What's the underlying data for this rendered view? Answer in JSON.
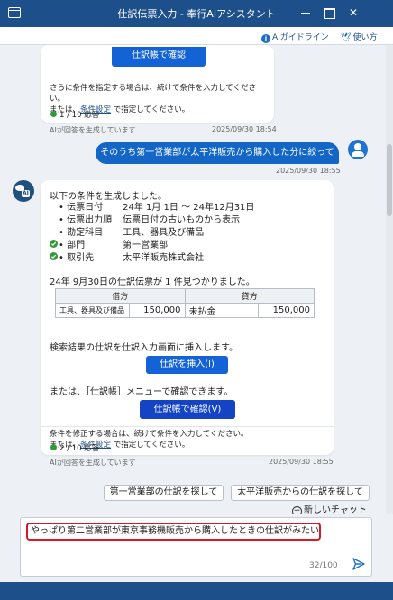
{
  "window": {
    "title": "仕訳伝票入力 - 奉行AIアシスタント"
  },
  "topbar": {
    "guide_label": "AIガイドライン",
    "usage_label": "使い方"
  },
  "msg1": {
    "button_label": "仕訳帳で確認",
    "line1": "さらに条件を指定する場合は、続けて条件を入力してください。",
    "line2_prefix": "または、",
    "link": "条件設定",
    "line2_suffix": " で指定してください。",
    "count": "1 / 10 応答",
    "note": "AIが回答を生成しています",
    "time": "2025/09/30 18:54"
  },
  "user_msg": {
    "text": "そのうち第一営業部が太平洋販売から購入した分に絞って",
    "time": "2025/09/30 18:55"
  },
  "msg2": {
    "intro": "以下の条件を生成しました。",
    "conditions": [
      {
        "label": "伝票日付",
        "value": "24年 1月 1日 ～ 24年12月31日"
      },
      {
        "label": "伝票出力順",
        "value": "伝票日付の古いものから表示"
      },
      {
        "label": "勘定科目",
        "value": "工具、器具及び備品"
      },
      {
        "label": "部門",
        "value": "第一営業部"
      },
      {
        "label": "取引先",
        "value": "太平洋販売株式会社"
      }
    ],
    "result": "24年 9月30日の仕訳伝票が 1 件見つかりました。",
    "table": {
      "debit_header": "借方",
      "credit_header": "貸方",
      "debit_account": "工具、器具及び備品",
      "debit_amount": "150,000",
      "credit_account": "未払金",
      "credit_amount": "150,000"
    },
    "insert_text": "検索結果の仕訳を仕訳入力画面に挿入します。",
    "insert_button": "仕訳を挿入(I)",
    "menu_text": "または、［仕訳帳］メニューで確認できます。",
    "confirm_button": "仕訳帳で確認(V)",
    "line1": "条件を修正する場合は、続けて条件を入力してください。",
    "line2_prefix": "または、",
    "link": "条件設定",
    "line2_suffix": " で指定してください。",
    "count": "2 / 10 応答",
    "note": "AIが回答を生成しています",
    "time": "2025/09/30 18:55"
  },
  "suggestions": [
    "第一営業部の仕訳を探して",
    "太平洋販売からの仕訳を探して"
  ],
  "new_chat": "新しいチャット",
  "input": {
    "value": "やっぱり第二営業部が東京事務機販売から購入したときの仕訳がみたい",
    "counter": "32/100"
  },
  "colors": {
    "title_bar": "#1d4f8a",
    "user_bubble": "#1366c6",
    "primary_button": "#1463d6",
    "highlight_border": "#d6182b",
    "check_green": "#2e9a3a"
  }
}
